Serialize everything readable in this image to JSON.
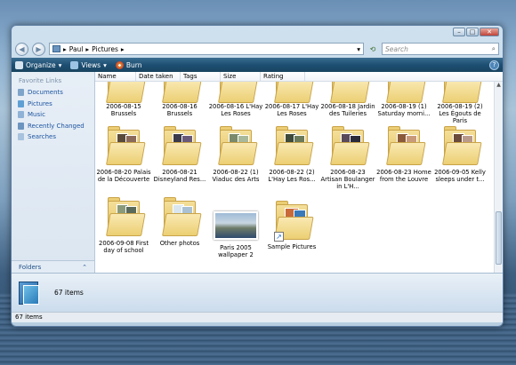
{
  "window": {
    "buttons": {
      "minimize": "–",
      "maximize": "□",
      "close": "✕"
    }
  },
  "address": {
    "crumbs": [
      "Paul",
      "Pictures"
    ],
    "separator": "▸",
    "search_placeholder": "Search"
  },
  "toolbar": {
    "organize": "Organize",
    "views": "Views",
    "burn": "Burn",
    "help": "?",
    "dropdown": "▾"
  },
  "nav": {
    "heading": "Favorite Links",
    "items": [
      "Documents",
      "Pictures",
      "Music",
      "Recently Changed",
      "Searches"
    ],
    "folders_label": "Folders",
    "folders_chevron": "⌃"
  },
  "columns": [
    "Name",
    "Date taken",
    "Tags",
    "Size",
    "Rating"
  ],
  "items_row1": [
    "2006-08-15 Brussels",
    "2006-08-16 Brussels",
    "2006-08-16 L'Hay Les Roses",
    "2006-08-17 L'Hay Les Roses",
    "2006-08-18 Jardin des Tuileries",
    "2006-08-19 (1) Saturday morni...",
    "2006-08-19 (2) Les Égouts de Paris"
  ],
  "items_row2": [
    "2006-08-20 Palais de la Découverte",
    "2006-08-21 Disneyland Res...",
    "2006-08-22 (1) Viaduc des Arts",
    "2006-08-22 (2) L'Hay Les Ros...",
    "2006-08-23 Artisan Boulanger in L'H...",
    "2006-08-23 Home from the Louvre",
    "2006-09-05 Kelly sleeps under t..."
  ],
  "items_row3": [
    "2006-09-08 First day of school",
    "Other photos",
    "Paris 2005 wallpaper 2",
    "Sample Pictures"
  ],
  "details": {
    "count": "67 items"
  },
  "status": {
    "count": "67 items"
  },
  "colors": {
    "toolbar": "#1d4f73",
    "link": "#1e55a1",
    "folder": "#e1bf5d"
  }
}
